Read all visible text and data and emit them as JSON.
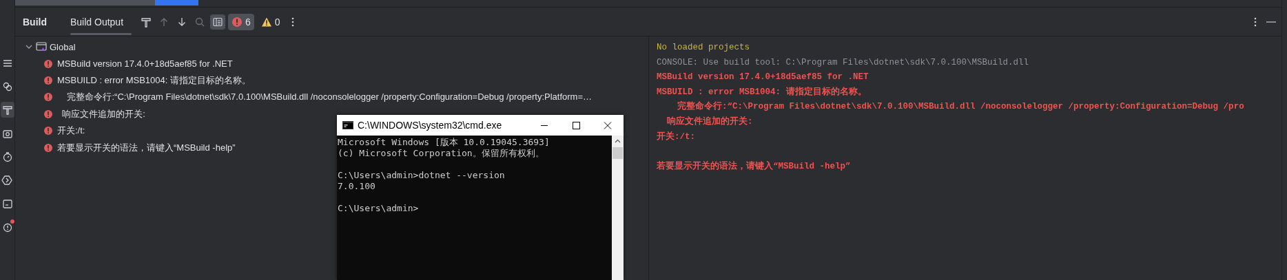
{
  "tool_strip": [
    {
      "kind": "list",
      "selected": false,
      "alert": false
    },
    {
      "kind": "branches",
      "selected": false,
      "alert": false
    },
    {
      "kind": "build",
      "selected": true,
      "alert": false
    },
    {
      "kind": "camera",
      "selected": false,
      "alert": false
    },
    {
      "kind": "timer",
      "selected": false,
      "alert": false
    },
    {
      "kind": "run",
      "selected": false,
      "alert": false
    },
    {
      "kind": "terminal",
      "selected": false,
      "alert": false
    },
    {
      "kind": "problems",
      "selected": false,
      "alert": true
    }
  ],
  "panel_title": "Build",
  "tabs": [
    {
      "label": "Build Output",
      "selected": true
    }
  ],
  "toolbar": [
    {
      "kind": "hammer",
      "disabled": false,
      "pressed": false
    },
    {
      "kind": "up",
      "disabled": true,
      "pressed": false
    },
    {
      "kind": "down",
      "disabled": false,
      "pressed": false
    },
    {
      "kind": "search",
      "disabled": true,
      "pressed": false
    },
    {
      "kind": "layout",
      "disabled": false,
      "pressed": true
    }
  ],
  "error_filter": {
    "count": "6",
    "pressed": true
  },
  "warning_filter": {
    "count": "0",
    "pressed": false
  },
  "tree": [
    {
      "label": "Global",
      "expanded": true,
      "children": [
        {
          "kind": "error",
          "label": "MSBuild version 17.4.0+18d5aef85 for .NET"
        },
        {
          "kind": "error",
          "label": "MSBUILD : error MSB1004: 请指定目标的名称。"
        },
        {
          "kind": "error",
          "label": "    完整命令行:“C:\\Program Files\\dotnet\\sdk\\7.0.100\\MSBuild.dll /noconsolelogger /property:Configuration=Debug /property:Platform=…"
        },
        {
          "kind": "error",
          "label": "  响应文件追加的开关:"
        },
        {
          "kind": "error",
          "label": "开关:/t:"
        },
        {
          "kind": "error",
          "label": "若要显示开关的语法，请键入“MSBuild -help”"
        }
      ]
    }
  ],
  "console": [
    {
      "kind": "info",
      "text": "No loaded projects",
      "gap_before": false
    },
    {
      "kind": "console",
      "text": "CONSOLE: Use build tool: C:\\Program Files\\dotnet\\sdk\\7.0.100\\MSBuild.dll",
      "gap_before": false
    },
    {
      "kind": "error",
      "text": "MSBuild version 17.4.0+18d5aef85 for .NET",
      "gap_before": false
    },
    {
      "kind": "error",
      "text": "MSBUILD : error MSB1004: 请指定目标的名称。",
      "gap_before": false
    },
    {
      "kind": "error",
      "text": "    完整命令行:“C:\\Program Files\\dotnet\\sdk\\7.0.100\\MSBuild.dll /noconsolelogger /property:Configuration=Debug /pro",
      "gap_before": false
    },
    {
      "kind": "error",
      "text": "  响应文件追加的开关:",
      "gap_before": false
    },
    {
      "kind": "error",
      "text": "开关:/t:",
      "gap_before": false
    },
    {
      "kind": "error",
      "text": "若要显示开关的语法，请键入“MSBuild -help”",
      "gap_before": true
    }
  ],
  "cmd_window": {
    "title": "C:\\WINDOWS\\system32\\cmd.exe",
    "lines": [
      {
        "text": "Microsoft Windows [版本 10.0.19045.3693]",
        "gap_before": false
      },
      {
        "text": "(c) Microsoft Corporation。保留所有权利。",
        "gap_before": false
      },
      {
        "text": "C:\\Users\\admin>dotnet --version",
        "gap_before": true
      },
      {
        "text": "7.0.100",
        "gap_before": false
      },
      {
        "text": "C:\\Users\\admin>",
        "gap_before": true
      }
    ]
  }
}
